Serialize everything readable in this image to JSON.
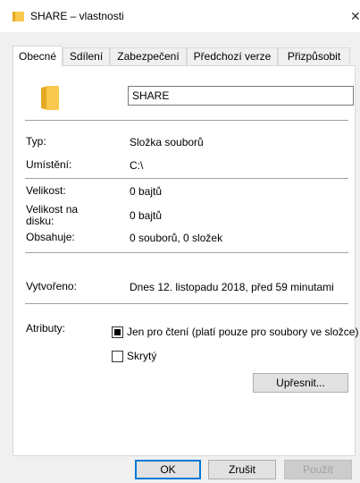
{
  "window": {
    "title": "SHARE – vlastnosti",
    "close_glyph": "✕"
  },
  "tabs": [
    {
      "label": "Obecné",
      "active": true
    },
    {
      "label": "Sdílení",
      "active": false
    },
    {
      "label": "Zabezpečení",
      "active": false
    },
    {
      "label": "Předchozí verze",
      "active": false
    },
    {
      "label": "Přizpůsobit",
      "active": false
    }
  ],
  "general": {
    "name_value": "SHARE",
    "rows": {
      "type": {
        "label": "Typ:",
        "value": "Složka souborů"
      },
      "location": {
        "label": "Umístění:",
        "value": "C:\\"
      },
      "size": {
        "label": "Velikost:",
        "value": "0 bajtů"
      },
      "size_on_disk": {
        "label": "Velikost na disku:",
        "value": "0 bajtů"
      },
      "contains": {
        "label": "Obsahuje:",
        "value": "0 souborů, 0 složek"
      },
      "created": {
        "label": "Vytvořeno:",
        "value": "Dnes 12. listopadu 2018, před 59 minutami"
      }
    },
    "attributes": {
      "label": "Atributy:",
      "readonly_label": "Jen pro čtení (platí pouze pro soubory ve složce)",
      "readonly_state": "indeterminate",
      "hidden_label": "Skrytý",
      "hidden_state": "unchecked",
      "advanced_button": "Upřesnit..."
    }
  },
  "footer": {
    "ok": "OK",
    "cancel": "Zrušit",
    "apply": "Použít"
  },
  "colors": {
    "folder": "#f8c94c",
    "accent": "#0078d7"
  },
  "icons": {
    "title": "folder-icon",
    "big": "folder-icon"
  }
}
